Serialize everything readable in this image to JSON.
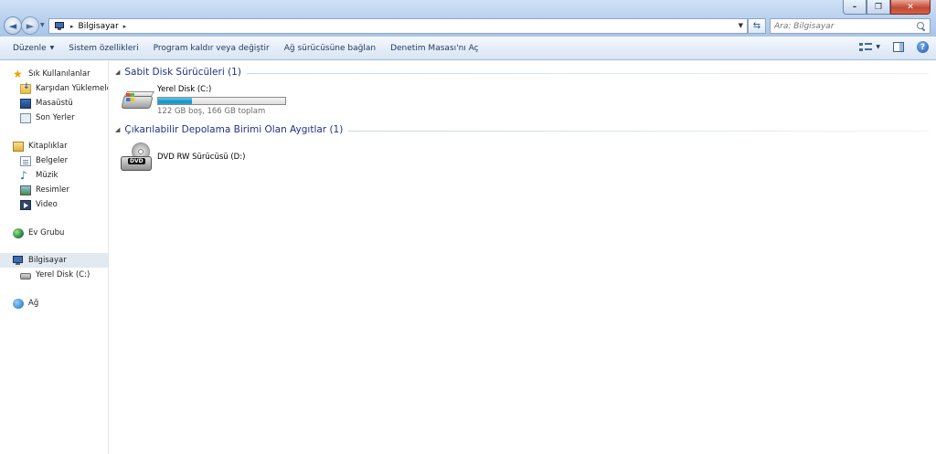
{
  "window": {
    "controls": {
      "minimize": "–",
      "maximize": "❐",
      "close": "✕"
    }
  },
  "address": {
    "separator": "▸",
    "location": "Bilgisayar",
    "trailing_separator": "▸"
  },
  "search": {
    "placeholder": "Ara: Bilgisayar"
  },
  "commands": {
    "organize": "Düzenle",
    "system_properties": "Sistem özellikleri",
    "uninstall": "Program kaldır veya değiştir",
    "map_drive": "Ağ sürücüsüne bağlan",
    "control_panel": "Denetim Masası'nı Aç"
  },
  "nav": {
    "favorites": "Sık Kullanılanlar",
    "downloads": "Karşıdan Yüklemeler",
    "desktop": "Masaüstü",
    "recent": "Son Yerler",
    "libraries": "Kitaplıklar",
    "documents": "Belgeler",
    "music": "Müzik",
    "pictures": "Resimler",
    "video": "Video",
    "homegroup": "Ev Grubu",
    "computer": "Bilgisayar",
    "local_disk": "Yerel Disk (C:)",
    "network": "Ağ"
  },
  "groups": {
    "hard_disks": "Sabit Disk Sürücüleri (1)",
    "removable": "Çıkarılabilir Depolama Birimi Olan Aygıtlar (1)"
  },
  "drives": {
    "c": {
      "name": "Yerel Disk (C:)",
      "space": "122 GB boş, 166 GB toplam",
      "used_fraction": 0.265
    },
    "d": {
      "name": "DVD RW Sürücüsü (D:)",
      "label": "DVD"
    }
  },
  "colors": {
    "group_title": "#1e3287",
    "usage_bar": "#1a8fc2"
  }
}
